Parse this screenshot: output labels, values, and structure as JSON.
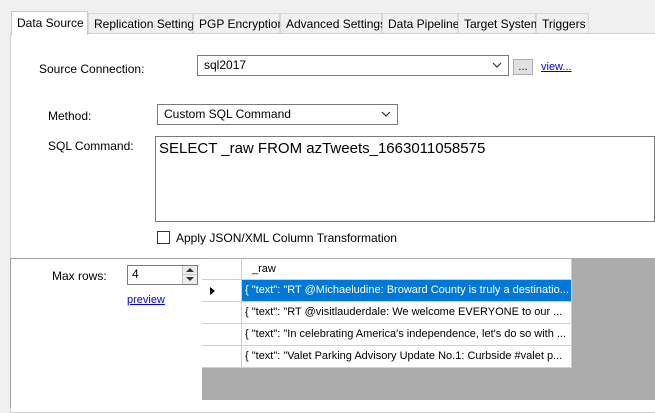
{
  "tabs": [
    {
      "label": "Data Source",
      "active": true
    },
    {
      "label": "Replication Settings"
    },
    {
      "label": "PGP Encryption"
    },
    {
      "label": "Advanced Settings"
    },
    {
      "label": "Data Pipeline"
    },
    {
      "label": "Target System"
    },
    {
      "label": "Triggers"
    }
  ],
  "source": {
    "label": "Source Connection:",
    "value": "sql2017",
    "browse_label": "...",
    "view_link": "view..."
  },
  "method": {
    "label": "Method:",
    "value": "Custom SQL Command"
  },
  "sql": {
    "label": "SQL Command:",
    "value": "SELECT _raw FROM azTweets_1663011058575"
  },
  "transform": {
    "label": "Apply JSON/XML Column Transformation",
    "checked": false
  },
  "preview": {
    "max_rows_label": "Max rows:",
    "max_rows_value": "4",
    "preview_link": "preview",
    "column_header": "_raw",
    "rows": [
      "{  \"text\": \"RT @Michaeludine: Broward County is truly a destinatio...",
      "{  \"text\": \"RT @visitlauderdale: We welcome EVERYONE to our ...",
      "{  \"text\": \"In celebrating America's independence, let's do so with ...",
      "{  \"text\": \"Valet Parking Advisory Update No.1: Curbside #valet p..."
    ],
    "selected_row": 0
  },
  "colors": {
    "selection": "#0078d7",
    "link": "#0000ee",
    "grid_background": "#ababab",
    "panel": "#ffffff",
    "window": "#f0f0f0"
  }
}
